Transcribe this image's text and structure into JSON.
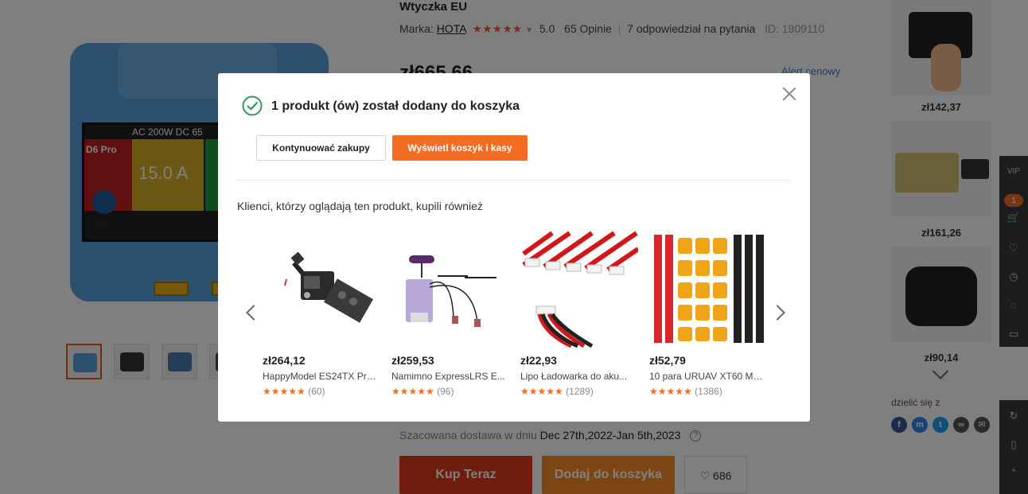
{
  "product": {
    "title": "Wtyczka EU",
    "brand_label": "Marka:",
    "brand_name": "HOTA",
    "rating_stars": "★★★★★",
    "rating_value": "5.0",
    "reviews": "65 Opinie",
    "questions": "7 odpowiedział na pytania",
    "id": "ID: 1909110",
    "price": "zł665,66",
    "price_alert": "Alert cenowy",
    "device_strip": "AC 200W  DC 65",
    "device_model": "D6 Pro",
    "device_reading": "15.0 A",
    "device_knob_label": "CH",
    "delivery_label": "Szacowana dostawa w dniu",
    "delivery_dates": "Dec 27th,2022-Jan 5th,2023",
    "delivery_help": "?",
    "buy_now": "Kup Teraz",
    "add_to_cart": "Dodaj do koszyka",
    "wish_icon": "heart-icon",
    "wish_count": "686"
  },
  "recommendations": {
    "prices": [
      "zł142,37",
      "zł161,26",
      "zł90,14"
    ],
    "share_label": "dzielić się z",
    "share_icons": [
      {
        "name": "facebook-icon",
        "glyph": "f",
        "color": "#3b5998"
      },
      {
        "name": "messenger-icon",
        "glyph": "m",
        "color": "#2c86f5"
      },
      {
        "name": "twitter-icon",
        "glyph": "t",
        "color": "#1da1f2"
      },
      {
        "name": "link-icon",
        "glyph": "∞",
        "color": "#555555"
      },
      {
        "name": "email-icon",
        "glyph": "✉",
        "color": "#555555"
      }
    ]
  },
  "sidebar": {
    "vip": "VIP",
    "cart_count": "1",
    "cart_icon": "cart-icon",
    "wishlist_icon": "heart-icon",
    "history_icon": "clock-icon",
    "chat_icon": "chat-icon",
    "coupon_icon": "coupon-icon",
    "support_icon": "headset-icon",
    "app_icon": "phone-icon",
    "top_icon": "chevron-up-icon"
  },
  "modal": {
    "title": "1 produkt (ów) został dodany do koszyka",
    "continue_label": "Kontynuować zakupy",
    "view_cart_label": "Wyświetl koszyk i kasy",
    "subtitle": "Klienci, którzy oglądają ten produkt, kupili również",
    "accent_color": "#f56d22",
    "success_color": "#2a9d5c",
    "products": [
      {
        "price": "zł264,12",
        "name": "HappyModel ES24TX Pro...",
        "stars": "★★★★★",
        "reviews": "(60)"
      },
      {
        "price": "zł259,53",
        "name": "Namimno ExpressLRS E...",
        "stars": "★★★★★",
        "reviews": "(96)"
      },
      {
        "price": "zł22,93",
        "name": "Lipo Ładowarka do aku...",
        "stars": "★★★★★",
        "reviews": "(1289)"
      },
      {
        "price": "zł52,79",
        "name": "10 para URUAV XT60 Mę...",
        "stars": "★★★★★",
        "reviews": "(1386)"
      }
    ]
  }
}
